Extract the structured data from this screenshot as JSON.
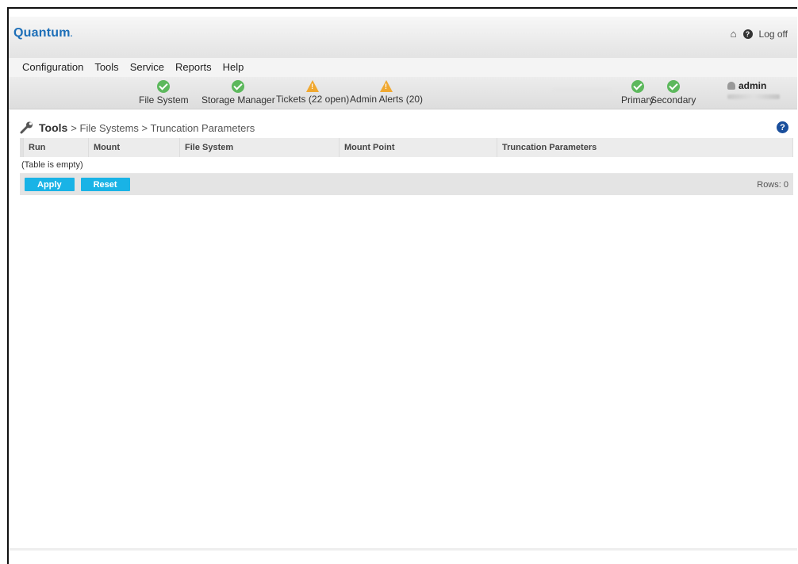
{
  "header": {
    "logo": "Quantum",
    "logo_suffix": ".",
    "logoff": "Log off"
  },
  "menu": {
    "items": [
      "Configuration",
      "Tools",
      "Service",
      "Reports",
      "Help"
    ]
  },
  "status": {
    "items": [
      {
        "label": "File System",
        "state": "ok"
      },
      {
        "label": "Storage Manager",
        "state": "ok"
      },
      {
        "label": "Tickets (22 open)",
        "state": "warning"
      },
      {
        "label": "Admin Alerts (20)",
        "state": "warning"
      },
      {
        "label": "Primary",
        "state": "ok"
      },
      {
        "label": "Secondary",
        "state": "ok"
      }
    ],
    "user": "admin"
  },
  "breadcrumb": {
    "root": "Tools",
    "path": "> File Systems > Truncation Parameters"
  },
  "table": {
    "columns": [
      "Run",
      "Mount",
      "File System",
      "Mount Point",
      "Truncation Parameters"
    ],
    "empty_text": "(Table is empty)"
  },
  "footer": {
    "apply": "Apply",
    "reset": "Reset",
    "rows": "Rows: 0"
  },
  "colors": {
    "brand": "#1d6fb8",
    "ok": "#5cb85c",
    "warning": "#f0a830",
    "button": "#19b3e6"
  }
}
